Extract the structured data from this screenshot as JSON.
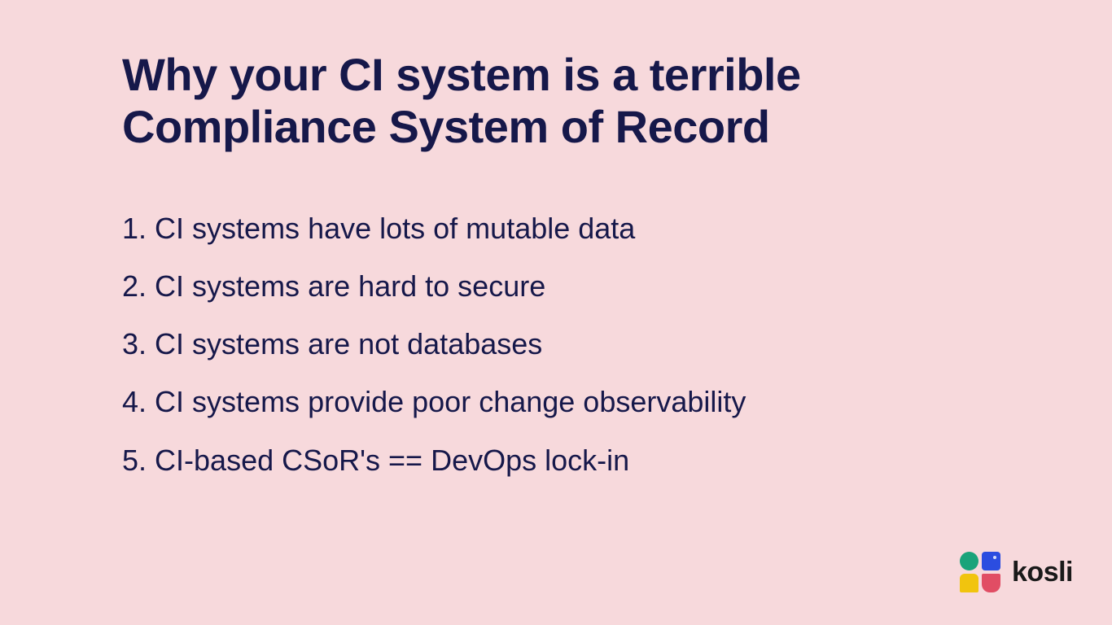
{
  "title": "Why your CI system is a terrible Compliance System of Record",
  "list": [
    "CI systems have lots of mutable data",
    "CI systems are hard to secure",
    "CI systems are not databases",
    "CI systems provide poor change observability",
    "CI-based CSoR's == DevOps lock-in"
  ],
  "brand": {
    "name": "kosli"
  }
}
